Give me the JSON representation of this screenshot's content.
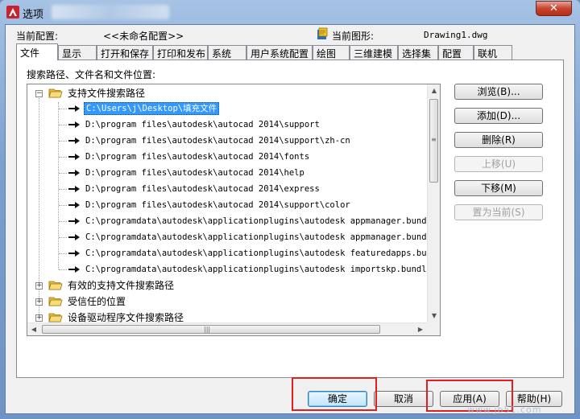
{
  "window": {
    "title": "选项",
    "close_label": "✕"
  },
  "header": {
    "current_profile_label": "当前配置:",
    "current_profile_value": "<<未命名配置>>",
    "current_drawing_label": "当前图形:",
    "current_drawing_value": "Drawing1.dwg"
  },
  "tabs": [
    {
      "label": "文件",
      "active": true
    },
    {
      "label": "显示"
    },
    {
      "label": "打开和保存"
    },
    {
      "label": "打印和发布"
    },
    {
      "label": "系统"
    },
    {
      "label": "用户系统配置"
    },
    {
      "label": "绘图"
    },
    {
      "label": "三维建模"
    },
    {
      "label": "选择集"
    },
    {
      "label": "配置"
    },
    {
      "label": "联机"
    }
  ],
  "section_label": "搜索路径、文件名和文件位置:",
  "tree": {
    "root_expanded": {
      "label": "支持文件搜索路径",
      "expander": "−",
      "children": [
        "C:\\Users\\j\\Desktop\\填充文件",
        "D:\\program files\\autodesk\\autocad 2014\\support",
        "D:\\program files\\autodesk\\autocad 2014\\support\\zh-cn",
        "D:\\program files\\autodesk\\autocad 2014\\fonts",
        "D:\\program files\\autodesk\\autocad 2014\\help",
        "D:\\program files\\autodesk\\autocad 2014\\express",
        "D:\\program files\\autodesk\\autocad 2014\\support\\color",
        "C:\\programdata\\autodesk\\applicationplugins\\autodesk appmanager.bundle\\",
        "C:\\programdata\\autodesk\\applicationplugins\\autodesk appmanager.bundle\\",
        "C:\\programdata\\autodesk\\applicationplugins\\autodesk featuredapps.bundl",
        "C:\\programdata\\autodesk\\applicationplugins\\autodesk importskp.bundle\\c"
      ],
      "selected_index": 0
    },
    "collapsed_nodes": [
      {
        "label": "有效的支持文件搜索路径",
        "expander": "+"
      },
      {
        "label": "受信任的位置",
        "expander": "+"
      },
      {
        "label": "设备驱动程序文件搜索路径",
        "expander": "+"
      }
    ]
  },
  "side_buttons": {
    "browse": "浏览(B)...",
    "add": "添加(D)...",
    "delete": "删除(R)",
    "move_up": "上移(U)",
    "move_down": "下移(M)",
    "set_current": "置为当前(S)"
  },
  "bottom_buttons": {
    "ok": "确定",
    "cancel": "取消",
    "apply": "应用(A)",
    "help": "帮助(H)"
  },
  "scroll": {
    "up": "▲",
    "down": "▼",
    "left": "◀",
    "right": "▶",
    "grip_v": "≡",
    "grip_h": "|||"
  },
  "watermark": "www.jb51.com",
  "colors": {
    "selection": "#3399ff",
    "highlight_box": "#e02020",
    "title_gradient": "#7aa0cf"
  }
}
